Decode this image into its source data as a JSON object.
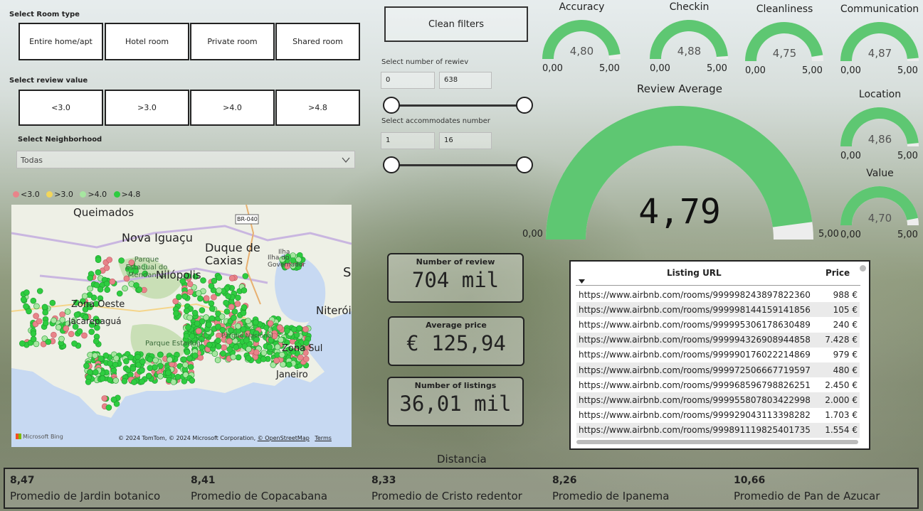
{
  "room_type": {
    "label": "Select Room type",
    "options": [
      "Entire home/apt",
      "Hotel room",
      "Private room",
      "Shared room"
    ]
  },
  "review_value": {
    "label": "Select review value",
    "options": [
      "<3.0",
      ">3.0",
      ">4.0",
      ">4.8"
    ]
  },
  "neighborhood": {
    "label": "Select Neighborhood",
    "selected": "Todas"
  },
  "clean_filters": "Clean filters",
  "reviews_slider": {
    "label": "Select number of rewiev",
    "min": "0",
    "max": "638"
  },
  "accommodates_slider": {
    "label": "Select accommodates number",
    "min": "1",
    "max": "16"
  },
  "legend": [
    {
      "label": "<3.0",
      "color": "#e8848a"
    },
    {
      "label": ">3.0",
      "color": "#f2d65a"
    },
    {
      "label": ">4.0",
      "color": "#a6e6a0"
    },
    {
      "label": ">4.8",
      "color": "#2ecc40"
    }
  ],
  "map": {
    "places": [
      "Queimados",
      "Nova Iguaçu",
      "Duque de Caxias",
      "Parque Estadual do Mendanha",
      "Nilópolis",
      "Zona Oeste",
      "Jacarepaguá",
      "Parque Estadual",
      "Niterói",
      "Janeiro",
      "BR-040",
      "Ilha do Governador",
      "Parque Nacional",
      "Zona Sul",
      "Ilha",
      "S"
    ],
    "bing": "Microsoft Bing",
    "copyright": "© 2024 TomTom, © 2024 Microsoft Corporation,",
    "osm": "© OpenStreetMap",
    "terms": "Terms"
  },
  "gauges": {
    "accuracy": {
      "title": "Accuracy",
      "value": "4,80",
      "min": "0,00",
      "max": "5,00",
      "fraction": 0.96
    },
    "checkin": {
      "title": "Checkin",
      "value": "4,88",
      "min": "0,00",
      "max": "5,00",
      "fraction": 0.976
    },
    "cleanliness": {
      "title": "Cleanliness",
      "value": "4,75",
      "min": "0,00",
      "max": "5,00",
      "fraction": 0.95
    },
    "communication": {
      "title": "Communication",
      "value": "4,87",
      "min": "0,00",
      "max": "5,00",
      "fraction": 0.974
    },
    "location": {
      "title": "Location",
      "value": "4,86",
      "min": "0,00",
      "max": "5,00",
      "fraction": 0.972
    },
    "value": {
      "title": "Value",
      "value": "4,70",
      "min": "0,00",
      "max": "5,00",
      "fraction": 0.94
    },
    "review_average": {
      "title": "Review Average",
      "value": "4,79",
      "min": "0,00",
      "max": "5,00",
      "fraction": 0.958
    }
  },
  "cards": {
    "reviews": {
      "label": "Number of review",
      "value": "704 mil"
    },
    "price": {
      "label": "Average price",
      "value": "€ 125,94"
    },
    "listings": {
      "label": "Number of listings",
      "value": "36,01 mil"
    }
  },
  "table": {
    "col_url": "Listing URL",
    "col_price": "Price",
    "rows": [
      {
        "url": "https://www.airbnb.com/rooms/999998243897822360",
        "price": "988 €"
      },
      {
        "url": "https://www.airbnb.com/rooms/999998144159141856",
        "price": "105 €"
      },
      {
        "url": "https://www.airbnb.com/rooms/999995306178630489",
        "price": "240 €"
      },
      {
        "url": "https://www.airbnb.com/rooms/999994326908944858",
        "price": "7.428 €"
      },
      {
        "url": "https://www.airbnb.com/rooms/999990176022214869",
        "price": "979 €"
      },
      {
        "url": "https://www.airbnb.com/rooms/999972506667719597",
        "price": "480 €"
      },
      {
        "url": "https://www.airbnb.com/rooms/999968596798826251",
        "price": "2.450 €"
      },
      {
        "url": "https://www.airbnb.com/rooms/999955807803422998",
        "price": "2.000 €"
      },
      {
        "url": "https://www.airbnb.com/rooms/999929043113398282",
        "price": "1.703 €"
      },
      {
        "url": "https://www.airbnb.com/rooms/999891119825401735",
        "price": "1.554 €"
      }
    ]
  },
  "distancia": {
    "title": "Distancia",
    "items": [
      {
        "value": "8,47",
        "label": "Promedio de Jardin botanico"
      },
      {
        "value": "8,41",
        "label": "Promedio de Copacabana"
      },
      {
        "value": "8,33",
        "label": "Promedio de Cristo redentor"
      },
      {
        "value": "8,26",
        "label": "Promedio de Ipanema"
      },
      {
        "value": "10,66",
        "label": "Promedio de Pan de Azucar"
      }
    ]
  },
  "colors": {
    "gauge_fill": "#5ec772",
    "gauge_track": "#ededed",
    "map_water": "#c7d9f2",
    "map_land": "#eef0e6"
  }
}
